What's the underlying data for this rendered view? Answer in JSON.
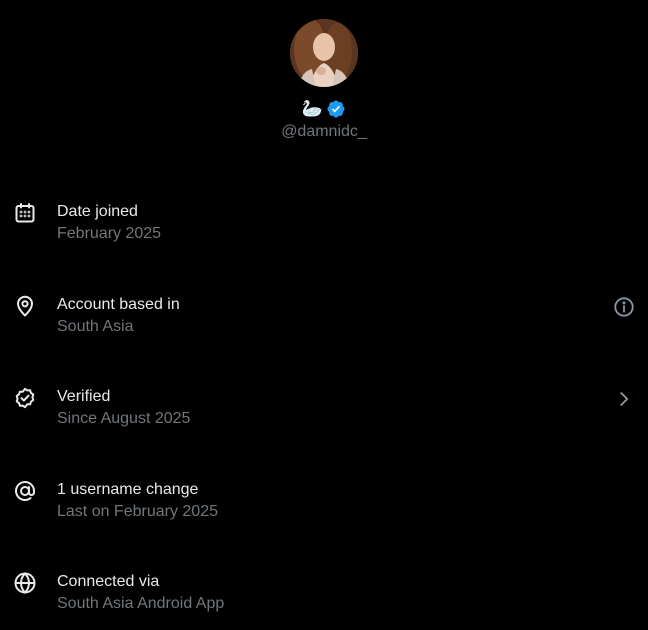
{
  "profile": {
    "emoji": "🦢",
    "handle": "@damnidc_",
    "avatar_icon": "avatar-photo",
    "verified_color": "#1d9bf0"
  },
  "rows": [
    {
      "icon": "calendar-icon",
      "title": "Date joined",
      "subtitle": "February 2025"
    },
    {
      "icon": "location-pin-icon",
      "title": "Account based in",
      "subtitle": "South Asia",
      "action": "info-icon"
    },
    {
      "icon": "verified-check-icon",
      "title": "Verified",
      "subtitle": "Since August 2025",
      "action": "chevron-right-icon"
    },
    {
      "icon": "at-sign-icon",
      "title": "1 username change",
      "subtitle": "Last on February 2025"
    },
    {
      "icon": "globe-icon",
      "title": "Connected via",
      "subtitle": "South Asia Android App"
    }
  ],
  "colors": {
    "background": "#000000",
    "primary_text": "#e7e9ea",
    "secondary_text": "#71767b"
  }
}
